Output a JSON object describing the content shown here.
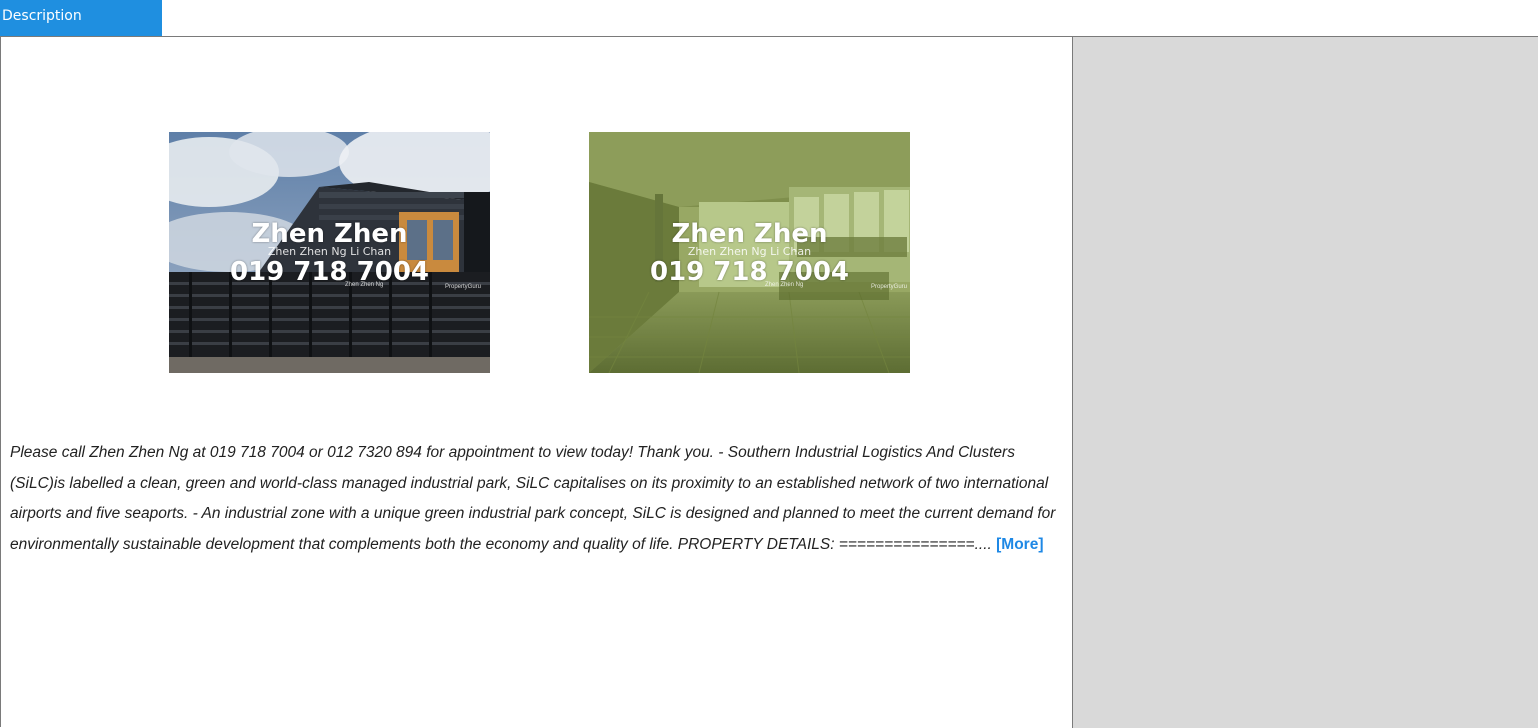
{
  "tab": {
    "label": "Description"
  },
  "photos": [
    {
      "watermark_name": "Zhen Zhen",
      "watermark_sub": "Zhen Zhen Ng Li Chan",
      "watermark_phone": "019 718 7004",
      "watermark_agent": "Zhen Zhen Ng",
      "watermark_brand": "PropertyGuru"
    },
    {
      "watermark_name": "Zhen Zhen",
      "watermark_sub": "Zhen Zhen Ng Li Chan",
      "watermark_phone": "019 718 7004",
      "watermark_agent": "Zhen Zhen Ng",
      "watermark_brand": "PropertyGuru"
    }
  ],
  "description": {
    "text": "Please call Zhen Zhen Ng at 019 718 7004 or 012 7320 894 for appointment to view today! Thank you.   - Southern Industrial Logistics And Clusters (SiLC)is labelled a clean, green and world-class managed industrial park, SiLC capitalises on its proximity to an established network of two international airports and five seaports. - An industrial zone with a unique green industrial park concept, SiLC is designed and planned to meet the current demand for environmentally sustainable development that complements both the economy and quality of life.   PROPERTY DETAILS:  ===============.... ",
    "more_label": "[More]"
  },
  "colors": {
    "tab_bg": "#1f8fe0",
    "link": "#1e88e5",
    "sidebar_bg": "#d9d9d9"
  }
}
